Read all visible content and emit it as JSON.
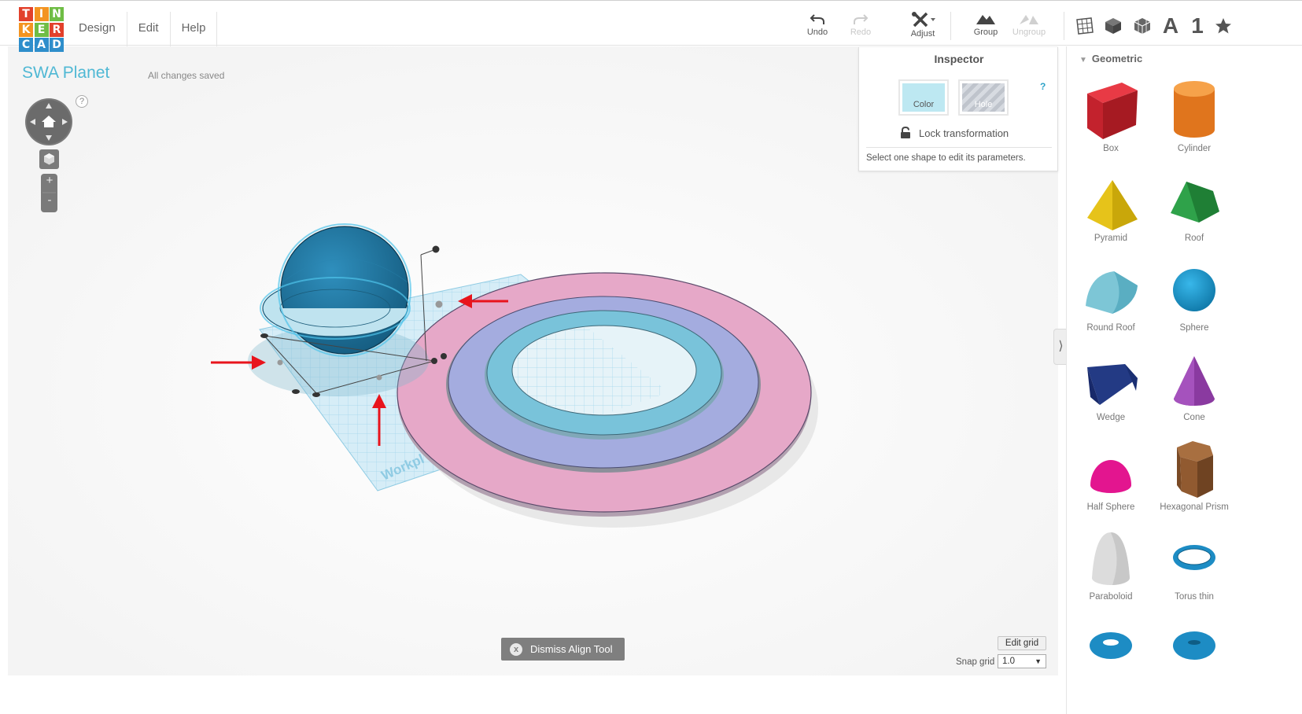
{
  "logo": {
    "letters": [
      [
        "T",
        "I",
        "N"
      ],
      [
        "K",
        "E",
        "R"
      ],
      [
        "C",
        "A",
        "D"
      ]
    ],
    "colors": {
      "red": "#e2402b",
      "orange": "#f39421",
      "green": "#6fbd45",
      "blue": "#2e8ecb"
    }
  },
  "menu": {
    "items": [
      "Design",
      "Edit",
      "Help"
    ]
  },
  "toolbar": {
    "undo": "Undo",
    "redo": "Redo",
    "adjust": "Adjust",
    "group": "Group",
    "ungroup": "Ungroup"
  },
  "view_icons": {
    "text_label": "A",
    "number_label": "1"
  },
  "project": {
    "title": "SWA Planet",
    "save_status": "All changes saved"
  },
  "nav": {
    "help": "?",
    "zoom_in": "+",
    "zoom_out": "-"
  },
  "inspector": {
    "title": "Inspector",
    "color_label": "Color",
    "hole_label": "Hole",
    "help": "?",
    "lock_label": "Lock transformation",
    "hint": "Select one shape to edit its parameters.",
    "color_swatch": "#bde8f2"
  },
  "panel": {
    "section": "Geometric",
    "shapes": [
      {
        "label": "Box"
      },
      {
        "label": "Cylinder"
      },
      {
        "label": "Pyramid"
      },
      {
        "label": "Roof"
      },
      {
        "label": "Round Roof"
      },
      {
        "label": "Sphere"
      },
      {
        "label": "Wedge"
      },
      {
        "label": "Cone"
      },
      {
        "label": "Half Sphere"
      },
      {
        "label": "Hexagonal Prism"
      },
      {
        "label": "Paraboloid"
      },
      {
        "label": "Torus thin"
      },
      {
        "label": ""
      },
      {
        "label": ""
      }
    ]
  },
  "workplane": {
    "label": "Workpl"
  },
  "bottom": {
    "dismiss_label": "Dismiss Align Tool",
    "dismiss_icon": "x",
    "edit_grid": "Edit grid",
    "snap_label": "Snap grid",
    "snap_value": "1.0"
  },
  "colors": {
    "accent": "#4fb8d4",
    "sphere": "#1f7aa6",
    "ring_pink": "#e6a8c8",
    "ring_lavender": "#a4acdf",
    "ring_blue": "#79c3da",
    "arrow": "#e8141c"
  }
}
